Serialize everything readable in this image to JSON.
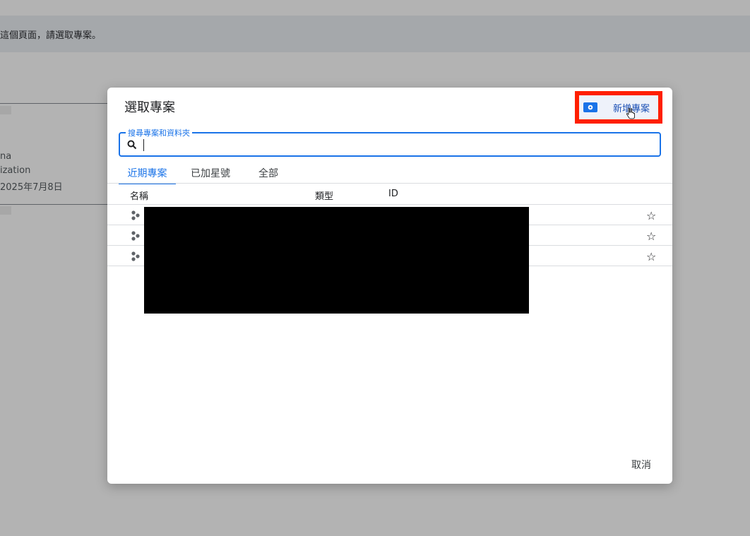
{
  "background": {
    "banner_text": "這個頁面，請選取專案。",
    "lines": [
      "na",
      "ization",
      "2025年7月8日"
    ]
  },
  "dialog": {
    "title": "選取專案",
    "new_project": {
      "label": "新增專案",
      "icon": "project-settings-icon",
      "highlight_color": "#ff1f00"
    },
    "search": {
      "label": "搜尋專案和資料夾",
      "value": "",
      "placeholder": ""
    },
    "tabs": [
      {
        "label": "近期專案",
        "active": true
      },
      {
        "label": "已加星號",
        "active": false
      },
      {
        "label": "全部",
        "active": false
      }
    ],
    "table": {
      "columns": [
        "名稱",
        "類型",
        "ID"
      ],
      "rows": [
        {
          "icon": "project-icon",
          "starred": false
        },
        {
          "icon": "project-icon",
          "starred": false
        },
        {
          "icon": "project-icon",
          "starred": false
        }
      ]
    },
    "cancel_label": "取消"
  },
  "colors": {
    "accent": "#1a73e8",
    "highlight": "#ff1f00",
    "redaction": "#000000"
  }
}
